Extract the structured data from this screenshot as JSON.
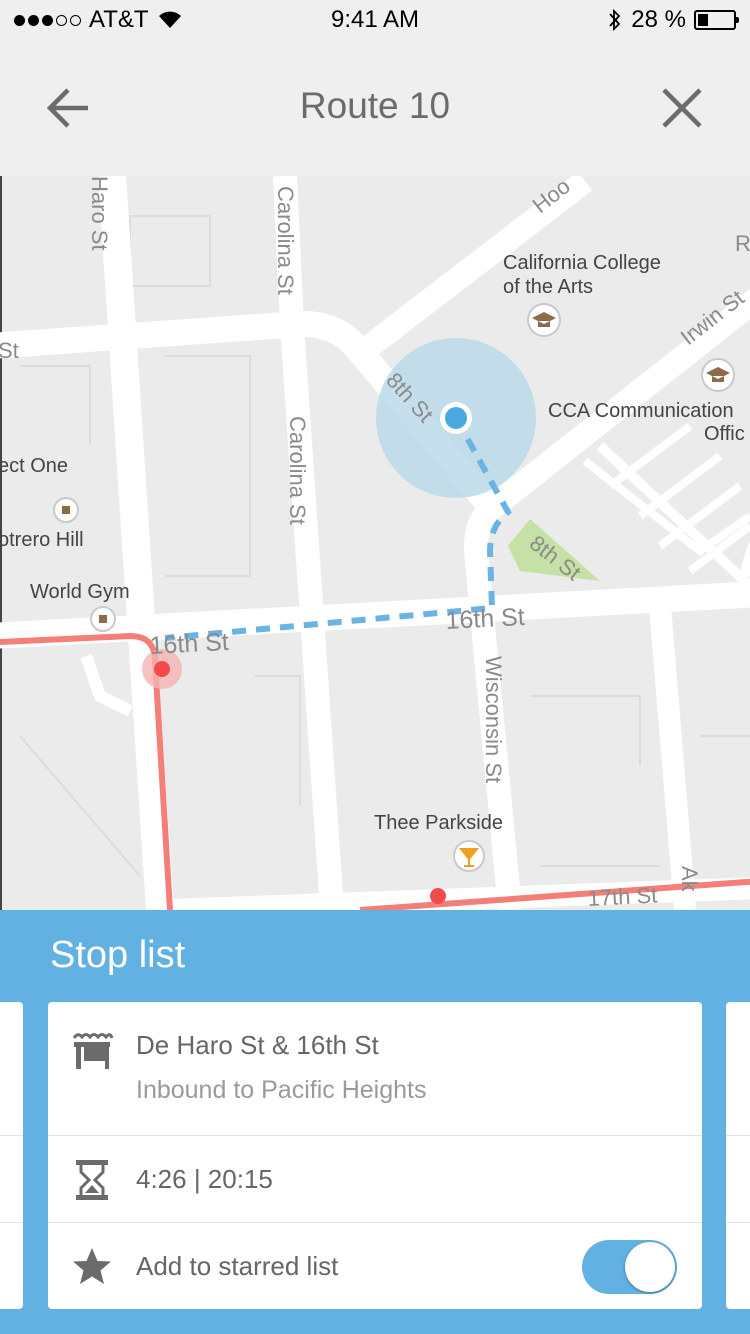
{
  "status_bar": {
    "carrier": "AT&T",
    "time": "9:41 AM",
    "battery_percent": "28 %",
    "battery_level": 0.28,
    "signal_bars_filled": 3,
    "signal_bars_total": 5
  },
  "nav": {
    "title": "Route 10",
    "back_icon": "arrow-left-icon",
    "close_icon": "close-icon"
  },
  "map": {
    "streets": {
      "de_haro_top": "Haro St",
      "carolina_top": "Carolina St",
      "carolina_mid": "Carolina St",
      "eighth_st": "8th St",
      "eighth_st_park": "8th St",
      "hooper": "Hoo",
      "irwin": "Irwin St",
      "sixteenth_left": "16th St",
      "sixteenth_right": "16th St",
      "wisconsin": "Wisconsin St",
      "seventeenth": "17th St",
      "left_st": "St",
      "ak": "Ak",
      "r": "R"
    },
    "places": {
      "cca_line1": "California College",
      "cca_line2": "of the Arts",
      "cca_comm_line1": "CCA Communication",
      "cca_comm_line2": "Offic",
      "project_one": "ect One",
      "potrero_hill": "otrero Hill",
      "world_gym": "World Gym",
      "thee_parkside": "Thee Parkside"
    },
    "colors": {
      "route_red": "#f47e78",
      "walk_blue": "#6ab3e3",
      "stop_red": "#f44a4a",
      "location_blue": "#4aa8e0",
      "park_green": "#c5e1a5"
    }
  },
  "panel": {
    "title": "Stop list",
    "stop": {
      "name": "De Haro St & 16th St",
      "direction": "Inbound to Pacific Heights",
      "times": "4:26 | 20:15",
      "star_label": "Add to starred list",
      "starred": true
    },
    "icons": {
      "stop": "bus-stop-icon",
      "time": "hourglass-icon",
      "star": "star-icon"
    },
    "background": "#62b1e2"
  }
}
